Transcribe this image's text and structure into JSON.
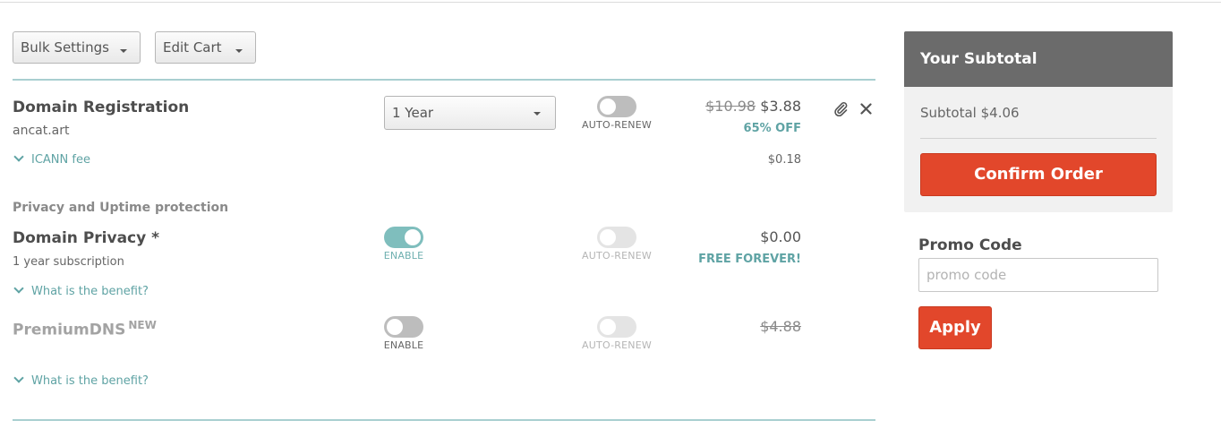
{
  "toolbar": {
    "bulk_settings_label": "Bulk Settings",
    "edit_cart_label": "Edit Cart"
  },
  "domain_registration": {
    "title": "Domain Registration",
    "domain": "ancat.art",
    "period_selected": "1 Year",
    "auto_renew_label": "AUTO-RENEW",
    "auto_renew_on": false,
    "old_price": "$10.98",
    "price": "$3.88",
    "discount": "65% OFF",
    "icann_fee_label": "ICANN fee",
    "icann_fee": "$0.18"
  },
  "protection_section": {
    "heading": "Privacy and Uptime protection"
  },
  "domain_privacy": {
    "title": "Domain Privacy *",
    "subtitle": "1 year subscription",
    "enable_label": "ENABLE",
    "enabled": true,
    "auto_renew_label": "AUTO-RENEW",
    "price": "$0.00",
    "badge": "FREE FOREVER!",
    "benefit_link": "What is the benefit?"
  },
  "premium_dns": {
    "title": "PremiumDNS",
    "tag": "NEW",
    "enable_label": "ENABLE",
    "enabled": false,
    "auto_renew_label": "AUTO-RENEW",
    "price": "$4.88",
    "benefit_link": "What is the benefit?"
  },
  "summary": {
    "title": "Your Subtotal",
    "subtotal": "Subtotal $4.06",
    "confirm_label": "Confirm Order"
  },
  "promo": {
    "heading": "Promo Code",
    "placeholder": "promo code",
    "value": "",
    "apply_label": "Apply"
  },
  "colors": {
    "accent_teal": "#5fa3a4",
    "toggle_on": "#7fbebd",
    "cta_red": "#e2472b",
    "panel_header": "#6b6b6b"
  },
  "icons": [
    "chevron-down-icon",
    "paperclip-icon",
    "close-icon"
  ]
}
